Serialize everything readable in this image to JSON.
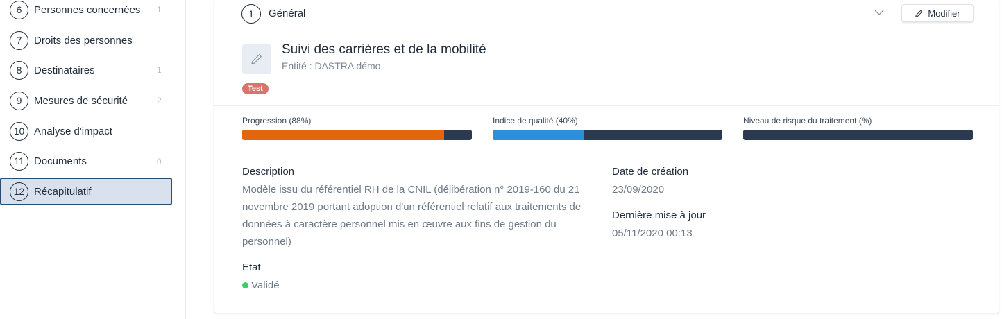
{
  "sidebar": {
    "items": [
      {
        "num": "6",
        "label": "Personnes concernées",
        "count": "1"
      },
      {
        "num": "7",
        "label": "Droits des personnes",
        "count": ""
      },
      {
        "num": "8",
        "label": "Destinataires",
        "count": "1"
      },
      {
        "num": "9",
        "label": "Mesures de sécurité",
        "count": "2"
      },
      {
        "num": "10",
        "label": "Analyse d'impact",
        "count": ""
      },
      {
        "num": "11",
        "label": "Documents",
        "count": "0"
      },
      {
        "num": "12",
        "label": "Récapitulatif",
        "count": ""
      }
    ],
    "active_index": 6
  },
  "section": {
    "num": "1",
    "title": "Général",
    "modify_label": "Modifier"
  },
  "treatment": {
    "title": "Suivi des carrières et de la mobilité",
    "entity": "Entité : DASTRA démo",
    "tag": "Test"
  },
  "metrics": [
    {
      "label": "Progression (88%)",
      "value": 0.88,
      "color": "#e5650c"
    },
    {
      "label": "Indice de qualité (40%)",
      "value": 0.4,
      "color": "#2d8fd8"
    },
    {
      "label": "Niveau de risque du traitement (%)",
      "value": 0,
      "color": "#2b3a50"
    }
  ],
  "details": {
    "description_label": "Description",
    "description": "Modèle issu du référentiel RH de la CNIL (délibération n° 2019-160 du 21 novembre 2019 portant adoption d'un référentiel relatif aux traitements de données à caractère personnel mis en œuvre aux fins de gestion du personnel)",
    "state_label": "Etat",
    "state": "Validé",
    "state_color": "#3bcf6a",
    "created_label": "Date de création",
    "created": "23/09/2020",
    "updated_label": "Dernière mise à jour",
    "updated": "05/11/2020 00:13"
  }
}
